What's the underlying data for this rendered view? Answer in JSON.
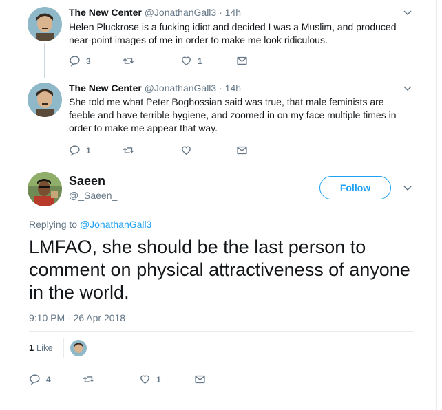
{
  "tweets": [
    {
      "name": "The New Center",
      "handle": "@JonathanGall3",
      "time": "14h",
      "text": "Helen Pluckrose is a fucking idiot and decided I was a Muslim, and produced near-point images of me in order to make me look ridiculous.",
      "replies": "3",
      "retweets": "",
      "likes": "1"
    },
    {
      "name": "The New Center",
      "handle": "@JonathanGall3",
      "time": "14h",
      "text": "She told me what Peter Boghossian said was true, that male feminists are feeble and have terrible hygiene, and zoomed in on my face multiple times in order to make me appear that way.",
      "replies": "1",
      "retweets": "",
      "likes": ""
    }
  ],
  "main_tweet": {
    "name": "Saeen",
    "handle": "@_Saeen_",
    "follow_label": "Follow",
    "replying_prefix": "Replying to",
    "replying_to": "@JonathanGall3",
    "text": "LMFAO, she should be the last person to comment on physical attractiveness of anyone in the world.",
    "timestamp": "9:10 PM - 26 Apr 2018",
    "likes_count": "1",
    "likes_label": "Like",
    "replies": "4",
    "retweets": "",
    "likes": "1"
  },
  "separator_dot": "·",
  "colors": {
    "accent": "#1da1f2",
    "muted": "#657786",
    "border": "#e6ecf0"
  }
}
